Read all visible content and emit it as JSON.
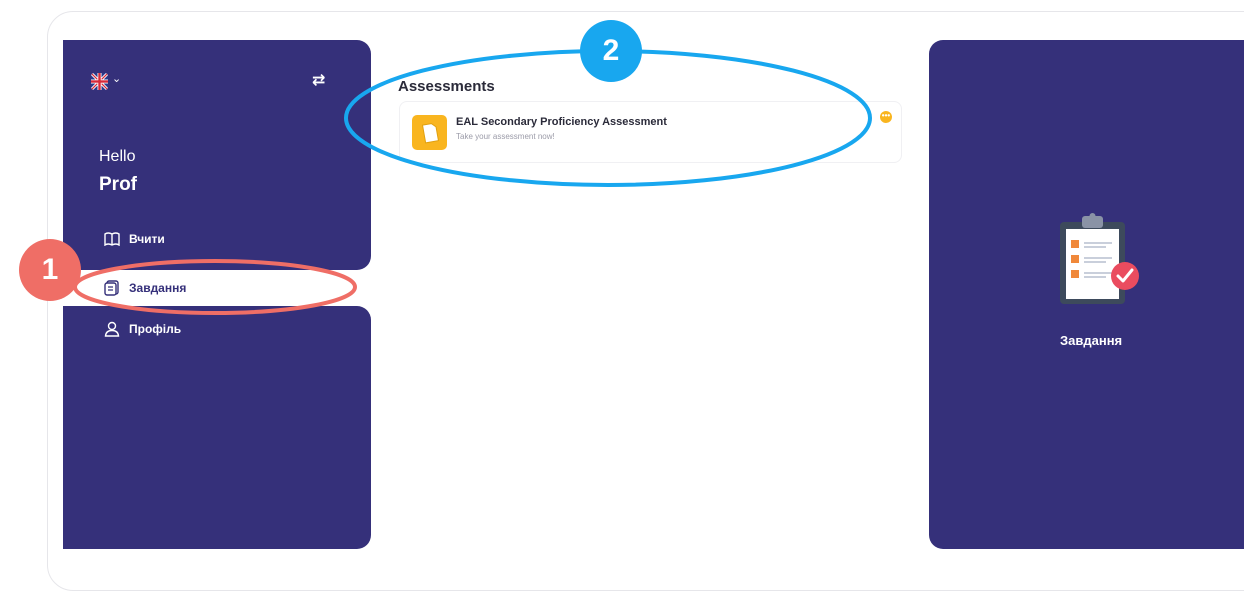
{
  "sidebar": {
    "language_icon": "uk-flag-icon",
    "chevron": "⌄",
    "swap_icon": "⇄",
    "greeting": "Hello",
    "user_name": "Prof",
    "items": [
      {
        "label": "Вчити",
        "icon": "book-icon"
      },
      {
        "label": "Завдання",
        "icon": "tasks-icon",
        "active": true
      },
      {
        "label": "Профіль",
        "icon": "user-icon"
      }
    ]
  },
  "main": {
    "section_title": "Assessments",
    "assessment": {
      "title": "EAL Secondary Proficiency Assessment",
      "subtitle": "Take your assessment now!",
      "more": "•••"
    }
  },
  "right_panel": {
    "icon": "clipboard-checklist-icon",
    "label": "Завдання"
  },
  "annotations": [
    {
      "number": "1",
      "color": "#ef6e66"
    },
    {
      "number": "2",
      "color": "#18a7ef"
    }
  ],
  "colors": {
    "brand": "#35307a",
    "accent": "#f9b51f",
    "annotation_red": "#ef6e66",
    "annotation_blue": "#18a7ef"
  }
}
